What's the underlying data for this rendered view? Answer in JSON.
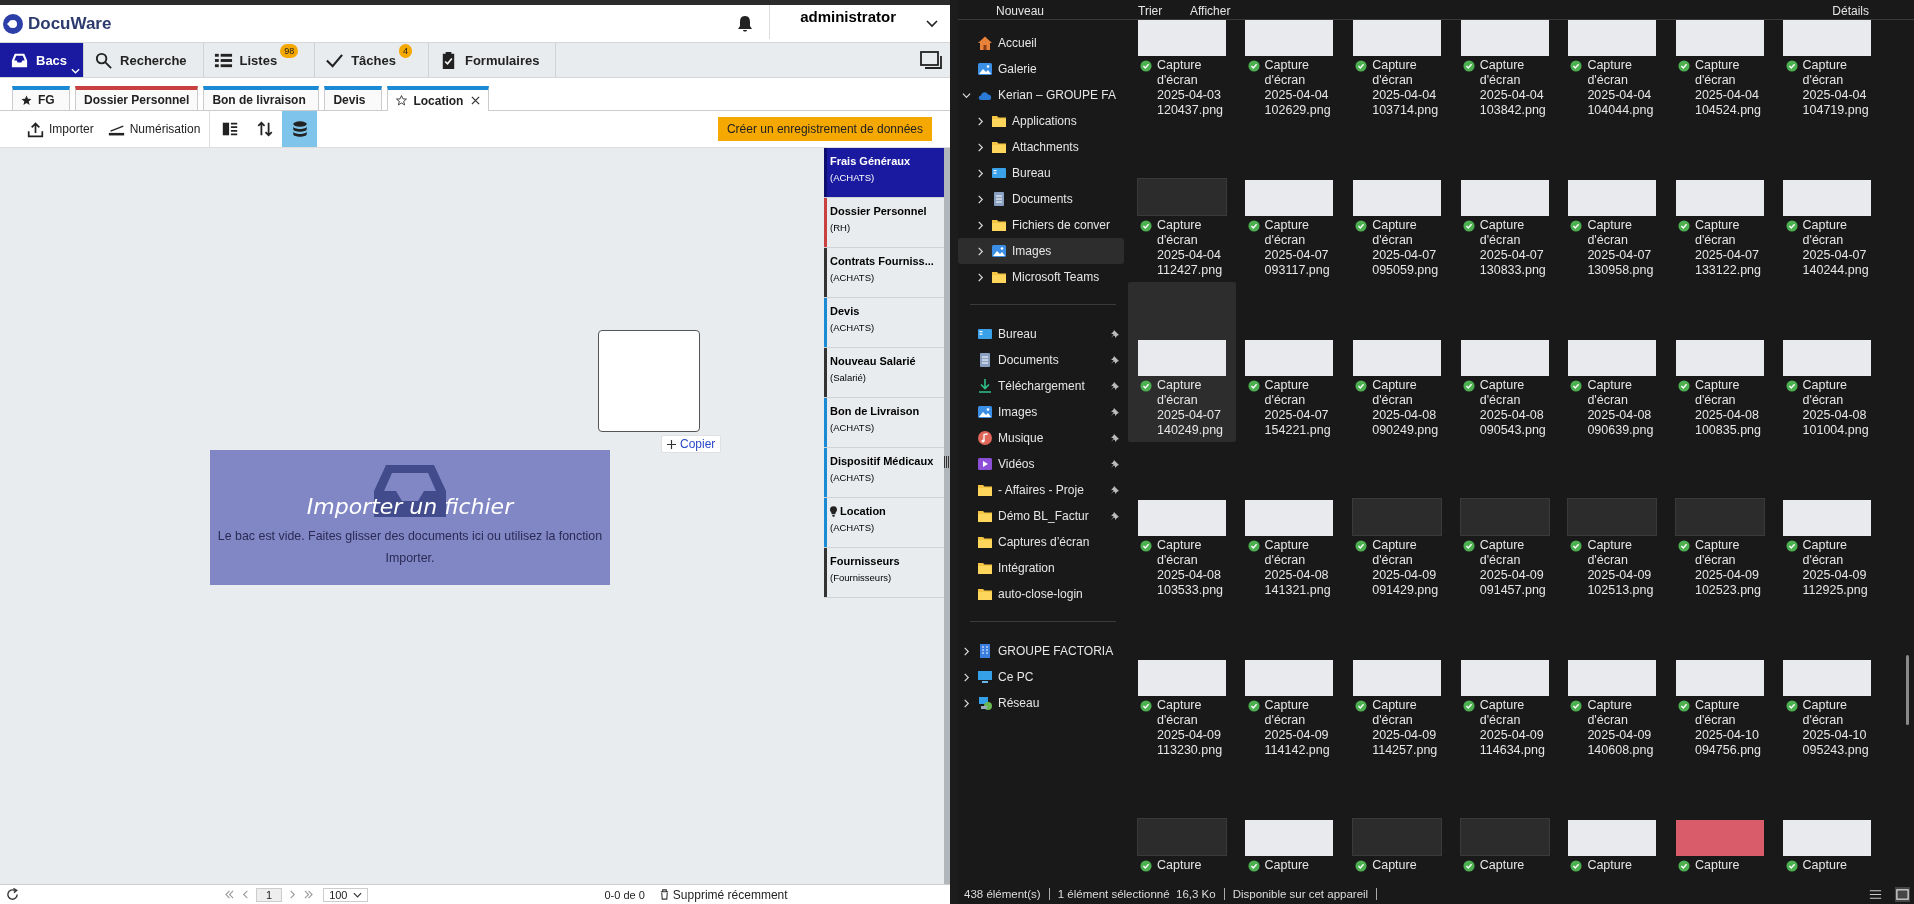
{
  "docuware": {
    "logo": "DocuWare",
    "user": "administrator",
    "nav": [
      {
        "label": "Bacs",
        "kind": "tray",
        "selected": true
      },
      {
        "label": "Recherche",
        "kind": "search",
        "selected": false
      },
      {
        "label": "Listes",
        "kind": "list",
        "badge": "98",
        "selected": false
      },
      {
        "label": "Tâches",
        "kind": "check",
        "badge": "4",
        "selected": false
      },
      {
        "label": "Formulaires",
        "kind": "form",
        "selected": false
      }
    ],
    "cabinet_tabs": [
      {
        "label": "FG",
        "kind": "starred",
        "color": "#1a8ad4",
        "closable": false,
        "selected": false
      },
      {
        "label": "Dossier Personnel",
        "kind": "plain",
        "color": "#c84040",
        "closable": false,
        "selected": false
      },
      {
        "label": "Bon de livraison",
        "kind": "plain",
        "color": "#1a8ad4",
        "closable": false,
        "selected": false
      },
      {
        "label": "Devis",
        "kind": "plain",
        "color": "#1a8ad4",
        "closable": false,
        "selected": false
      },
      {
        "label": "Location",
        "kind": "unstarred",
        "color": "#1a8ad4",
        "closable": true,
        "selected": true
      }
    ],
    "toolbar": [
      {
        "label": "Importer",
        "kind": "upload"
      },
      {
        "label": "Numérisation",
        "kind": "scanner"
      }
    ],
    "view_buttons": [
      {
        "kind": "panel",
        "selected": false
      },
      {
        "kind": "sort",
        "selected": false
      },
      {
        "kind": "database",
        "selected": true
      }
    ],
    "create_button": "Créer un enregistrement de données",
    "empty_state": {
      "title": "Importer un fichier",
      "message": "Le bac est vide. Faites glisser des documents ici ou utilisez la fonction Importer."
    },
    "copy_button": "Copier",
    "trays": [
      {
        "title": "Frais Généraux",
        "subtitle": "(ACHATS)",
        "kind": "plain",
        "color": "#0e0e70",
        "selected": true
      },
      {
        "title": "Dossier Personnel",
        "subtitle": "(RH)",
        "kind": "plain",
        "color": "#c84040",
        "selected": false
      },
      {
        "title": "Contrats Fourniss...",
        "subtitle": "(ACHATS)",
        "kind": "plain",
        "color": "#333333",
        "selected": false
      },
      {
        "title": "Devis",
        "subtitle": "(ACHATS)",
        "kind": "plain",
        "color": "#1a8ad4",
        "selected": false
      },
      {
        "title": "Nouveau Salarié",
        "subtitle": "(Salarié)",
        "kind": "plain",
        "color": "#333333",
        "selected": false
      },
      {
        "title": "Bon de Livraison",
        "subtitle": "(ACHATS)",
        "kind": "plain",
        "color": "#1a8ad4",
        "selected": false
      },
      {
        "title": "Dispositif Médicaux",
        "subtitle": "(ACHATS)",
        "kind": "plain",
        "color": "#1a8ad4",
        "selected": false
      },
      {
        "title": "Location",
        "subtitle": "(ACHATS)",
        "kind": "bulb",
        "color": "#1a8ad4",
        "selected": false
      },
      {
        "title": "Fournisseurs",
        "subtitle": "(Fournisseurs)",
        "kind": "plain",
        "color": "#333333",
        "selected": false
      }
    ],
    "footer": {
      "page": "1",
      "page_size": "100",
      "count": "0-0 de 0",
      "deleted": "Supprimé récemment"
    }
  },
  "explorer": {
    "toolbar": [
      "Nouveau",
      "Trier",
      "Afficher",
      "Détails"
    ],
    "nav_groups": [
      [
        {
          "label": "Accueil",
          "kind": "home",
          "selected": false
        },
        {
          "label": "Galerie",
          "kind": "gallery",
          "selected": false
        },
        {
          "label": "Kerian – GROUPE FA",
          "kind": "cloud",
          "expanded": true,
          "selected": false,
          "children": [
            {
              "label": "Applications",
              "kind": "folder",
              "expanded": false,
              "selected": false
            },
            {
              "label": "Attachments",
              "kind": "folder",
              "expanded": false,
              "selected": false
            },
            {
              "label": "Bureau",
              "kind": "desktop",
              "expanded": false,
              "selected": false
            },
            {
              "label": "Documents",
              "kind": "documents",
              "expanded": false,
              "selected": false
            },
            {
              "label": "Fichiers de conver",
              "kind": "folder",
              "expanded": false,
              "selected": false
            },
            {
              "label": "Images",
              "kind": "images",
              "expanded": false,
              "selected": true
            },
            {
              "label": "Microsoft Teams",
              "kind": "folder",
              "expanded": false,
              "selected": false
            }
          ]
        }
      ],
      [
        {
          "label": "Bureau",
          "kind": "desktop",
          "pinned": true,
          "selected": false
        },
        {
          "label": "Documents",
          "kind": "documents",
          "pinned": true,
          "selected": false
        },
        {
          "label": "Téléchargement",
          "kind": "download",
          "pinned": true,
          "selected": false
        },
        {
          "label": "Images",
          "kind": "images",
          "pinned": true,
          "selected": false
        },
        {
          "label": "Musique",
          "kind": "music",
          "pinned": true,
          "selected": false
        },
        {
          "label": "Vidéos",
          "kind": "video",
          "pinned": true,
          "selected": false
        },
        {
          "label": "- Affaires - Proje",
          "kind": "folder",
          "pinned": true,
          "selected": false
        },
        {
          "label": "Démo BL_Factur",
          "kind": "folder",
          "pinned": true,
          "selected": false
        },
        {
          "label": "Captures d’écran",
          "kind": "folder",
          "pinned": false,
          "selected": false
        },
        {
          "label": "Intégration",
          "kind": "folder",
          "pinned": false,
          "selected": false
        },
        {
          "label": "auto-close-login",
          "kind": "folder",
          "pinned": false,
          "selected": false
        }
      ],
      [
        {
          "label": "GROUPE FACTORIA",
          "kind": "building",
          "expanded": false,
          "selected": false
        },
        {
          "label": "Ce PC",
          "kind": "pc",
          "expanded": false,
          "selected": false
        },
        {
          "label": "Réseau",
          "kind": "network",
          "expanded": false,
          "selected": false
        }
      ]
    ],
    "files": [
      {
        "name": "Capture d'écran 2025-04-03 120437.png",
        "kind": "light",
        "selected": false
      },
      {
        "name": "Capture d'écran 2025-04-04 102629.png",
        "kind": "light",
        "selected": false
      },
      {
        "name": "Capture d'écran 2025-04-04 103714.png",
        "kind": "light",
        "selected": false
      },
      {
        "name": "Capture d'écran 2025-04-04 103842.png",
        "kind": "light",
        "selected": false
      },
      {
        "name": "Capture d'écran 2025-04-04 104044.png",
        "kind": "light",
        "selected": false
      },
      {
        "name": "Capture d'écran 2025-04-04 104524.png",
        "kind": "light",
        "selected": false
      },
      {
        "name": "Capture d'écran 2025-04-04 104719.png",
        "kind": "light",
        "selected": false
      },
      {
        "name": "Capture d'écran 2025-04-04 112427.png",
        "kind": "dark",
        "selected": false
      },
      {
        "name": "Capture d'écran 2025-04-07 093117.png",
        "kind": "light",
        "selected": false
      },
      {
        "name": "Capture d'écran 2025-04-07 095059.png",
        "kind": "light",
        "selected": false
      },
      {
        "name": "Capture d'écran 2025-04-07 130833.png",
        "kind": "light",
        "selected": false
      },
      {
        "name": "Capture d'écran 2025-04-07 130958.png",
        "kind": "light",
        "selected": false
      },
      {
        "name": "Capture d'écran 2025-04-07 133122.png",
        "kind": "light",
        "selected": false
      },
      {
        "name": "Capture d'écran 2025-04-07 140244.png",
        "kind": "light",
        "selected": false
      },
      {
        "name": "Capture d'écran 2025-04-07 140249.png",
        "kind": "light",
        "selected": true
      },
      {
        "name": "Capture d'écran 2025-04-07 154221.png",
        "kind": "light",
        "selected": false
      },
      {
        "name": "Capture d'écran 2025-04-08 090249.png",
        "kind": "light",
        "selected": false
      },
      {
        "name": "Capture d'écran 2025-04-08 090543.png",
        "kind": "light",
        "selected": false
      },
      {
        "name": "Capture d'écran 2025-04-08 090639.png",
        "kind": "light",
        "selected": false
      },
      {
        "name": "Capture d'écran 2025-04-08 100835.png",
        "kind": "light",
        "selected": false
      },
      {
        "name": "Capture d'écran 2025-04-08 101004.png",
        "kind": "light",
        "selected": false
      },
      {
        "name": "Capture d'écran 2025-04-08 103533.png",
        "kind": "light",
        "selected": false
      },
      {
        "name": "Capture d'écran 2025-04-08 141321.png",
        "kind": "light",
        "selected": false
      },
      {
        "name": "Capture d'écran 2025-04-09 091429.png",
        "kind": "dark",
        "selected": false
      },
      {
        "name": "Capture d'écran 2025-04-09 091457.png",
        "kind": "dark",
        "selected": false
      },
      {
        "name": "Capture d'écran 2025-04-09 102513.png",
        "kind": "dark",
        "selected": false
      },
      {
        "name": "Capture d'écran 2025-04-09 102523.png",
        "kind": "dark",
        "selected": false
      },
      {
        "name": "Capture d'écran 2025-04-09 112925.png",
        "kind": "light",
        "selected": false
      },
      {
        "name": "Capture d'écran 2025-04-09 113230.png",
        "kind": "light",
        "selected": false
      },
      {
        "name": "Capture d'écran 2025-04-09 114142.png",
        "kind": "light",
        "selected": false
      },
      {
        "name": "Capture d'écran 2025-04-09 114257.png",
        "kind": "light",
        "selected": false
      },
      {
        "name": "Capture d'écran 2025-04-09 114634.png",
        "kind": "light",
        "selected": false
      },
      {
        "name": "Capture d'écran 2025-04-09 140608.png",
        "kind": "light",
        "selected": false
      },
      {
        "name": "Capture d'écran 2025-04-10 094756.png",
        "kind": "light",
        "selected": false
      },
      {
        "name": "Capture d'écran 2025-04-10 095243.png",
        "kind": "light",
        "selected": false
      },
      {
        "name": "Capture",
        "kind": "dark",
        "selected": false
      },
      {
        "name": "Capture",
        "kind": "light",
        "selected": false
      },
      {
        "name": "Capture",
        "kind": "dark",
        "selected": false
      },
      {
        "name": "Capture",
        "kind": "dark",
        "selected": false
      },
      {
        "name": "Capture",
        "kind": "light",
        "selected": false
      },
      {
        "name": "Capture",
        "kind": "alert",
        "selected": false
      },
      {
        "name": "Capture",
        "kind": "light",
        "selected": false
      }
    ],
    "status": [
      "438 élément(s)",
      "1 élément sélectionné  16,3 Ko",
      "Disponible sur cet appareil"
    ]
  }
}
